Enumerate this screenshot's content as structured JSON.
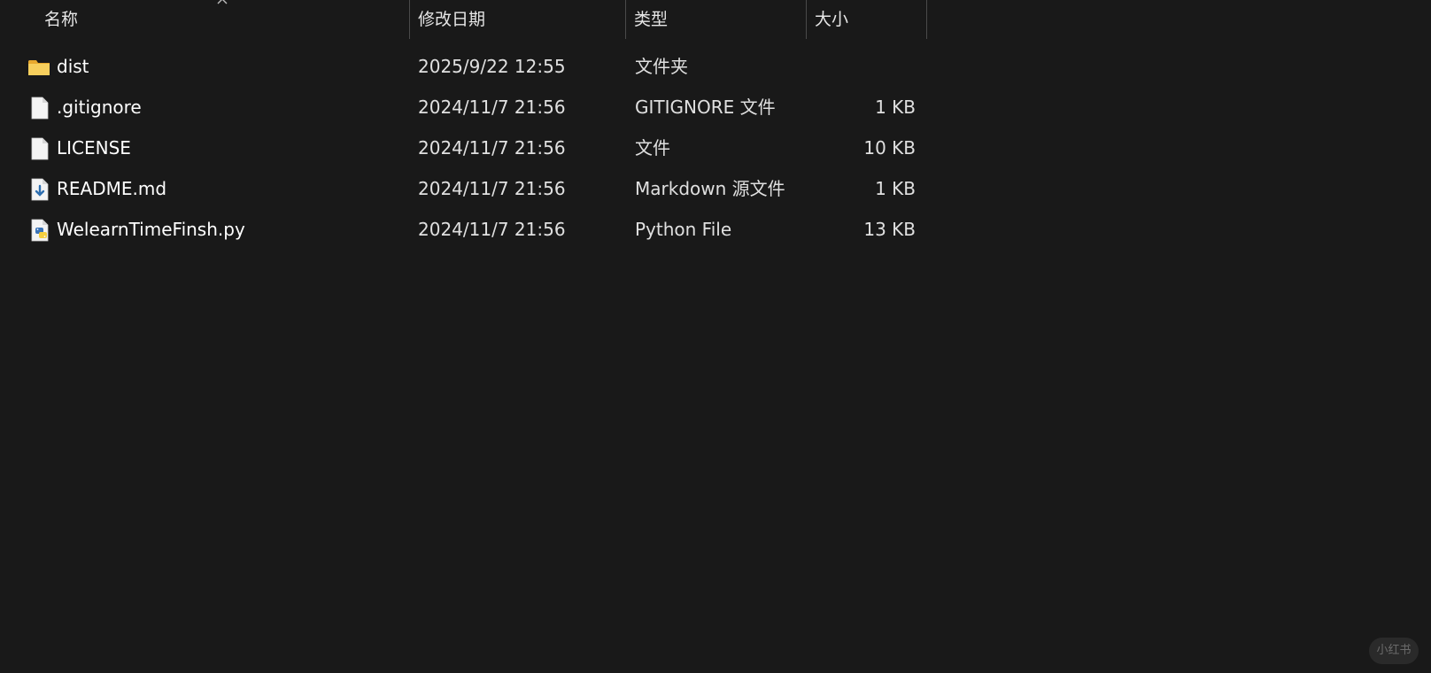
{
  "columns": {
    "name": "名称",
    "modified": "修改日期",
    "type": "类型",
    "size": "大小"
  },
  "sort": {
    "indicator_icon": "chevron-up-icon"
  },
  "files": [
    {
      "name": "dist",
      "modified": "2025/9/22 12:55",
      "type": "文件夹",
      "size": "",
      "icon": "folder-icon"
    },
    {
      "name": ".gitignore",
      "modified": "2024/11/7 21:56",
      "type": "GITIGNORE 文件",
      "size": "1 KB",
      "icon": "file-icon"
    },
    {
      "name": "LICENSE",
      "modified": "2024/11/7 21:56",
      "type": "文件",
      "size": "10 KB",
      "icon": "file-icon"
    },
    {
      "name": "README.md",
      "modified": "2024/11/7 21:56",
      "type": "Markdown 源文件",
      "size": "1 KB",
      "icon": "markdown-file-icon"
    },
    {
      "name": "WelearnTimeFinsh.py",
      "modified": "2024/11/7 21:56",
      "type": "Python File",
      "size": "13 KB",
      "icon": "python-file-icon"
    }
  ],
  "watermark": "小红书",
  "colors": {
    "background": "#191919",
    "folder": "#f2c14e",
    "text": "#ffffff"
  }
}
